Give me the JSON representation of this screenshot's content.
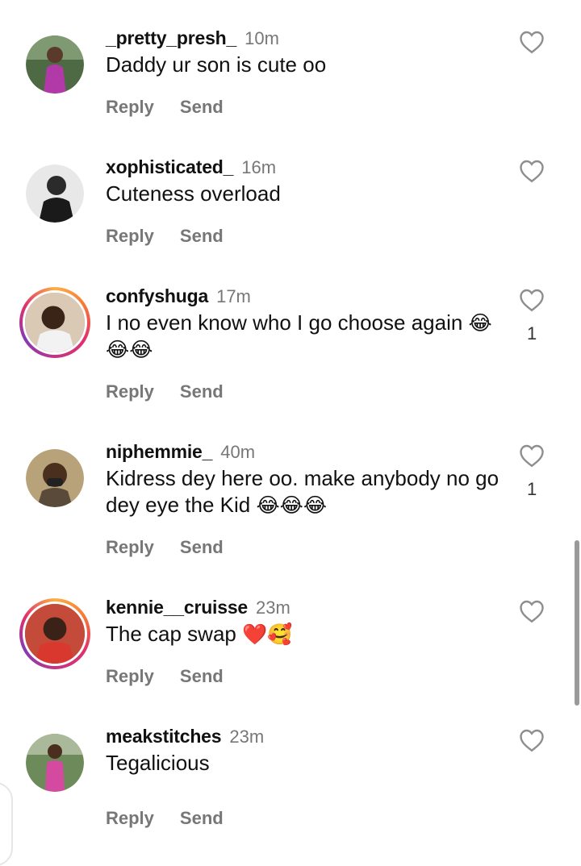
{
  "actions": {
    "reply": "Reply",
    "send": "Send"
  },
  "comments": [
    {
      "user": "_pretty_presh_",
      "time": "10m",
      "text": "Daddy ur son is cute oo",
      "emoji": "",
      "count": ""
    },
    {
      "user": "xophisticated_",
      "time": "16m",
      "text": "Cuteness overload",
      "emoji": "",
      "count": ""
    },
    {
      "user": "confyshuga",
      "time": "17m",
      "text": "I no even know who I go choose again",
      "emoji": "😂😂😂",
      "count": "1"
    },
    {
      "user": "niphemmie_",
      "time": "40m",
      "text": "Kidress dey here oo. make anybody no go dey eye the Kid",
      "emoji": "😂😂😂",
      "count": "1"
    },
    {
      "user": "kennie__cruisse",
      "time": "23m",
      "text": "The cap swap",
      "emoji": "❤️🥰",
      "count": ""
    },
    {
      "user": "meakstitches",
      "time": "23m",
      "text": "Tegalicious",
      "emoji": "",
      "count": ""
    }
  ],
  "colors": {
    "story_ring": [
      "#fcaf45",
      "#e1306c",
      "#833ab4"
    ],
    "muted": "#777777"
  },
  "icons": {
    "like": "heart-outline-icon"
  }
}
